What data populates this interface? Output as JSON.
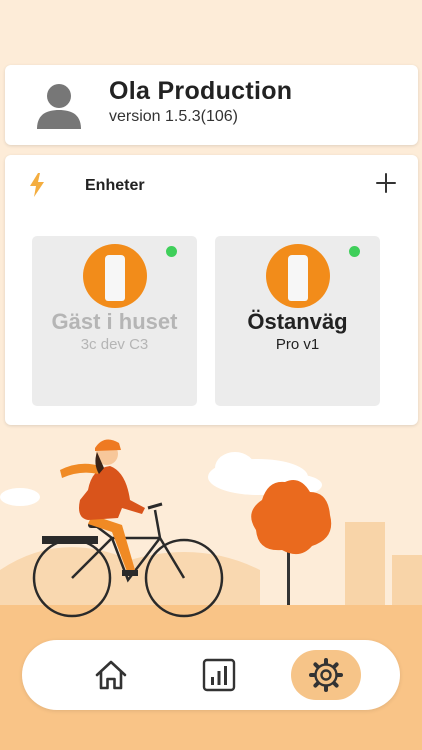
{
  "profile": {
    "name": "Ola Production",
    "version": "version 1.5.3(106)",
    "avatar_icon": "user-avatar-icon"
  },
  "devices_section": {
    "title": "Enheter",
    "section_icon": "lightning-bolt-icon",
    "add_icon": "plus-icon",
    "items": [
      {
        "name": "Gäst i huset",
        "subtitle": "3c dev C3",
        "status_color": "#3fcf5a",
        "disabled": true
      },
      {
        "name": "Östanväg",
        "subtitle": "Pro v1",
        "status_color": "#3fcf5a",
        "disabled": false
      }
    ]
  },
  "navbar": {
    "items": [
      {
        "icon": "home-icon",
        "active": false
      },
      {
        "icon": "stats-icon",
        "active": false
      },
      {
        "icon": "gear-icon",
        "active": true
      }
    ]
  },
  "colors": {
    "accent": "#f28c1a",
    "background": "#fdecd8",
    "active_tab": "#f6c488",
    "status_online": "#3fcf5a"
  }
}
